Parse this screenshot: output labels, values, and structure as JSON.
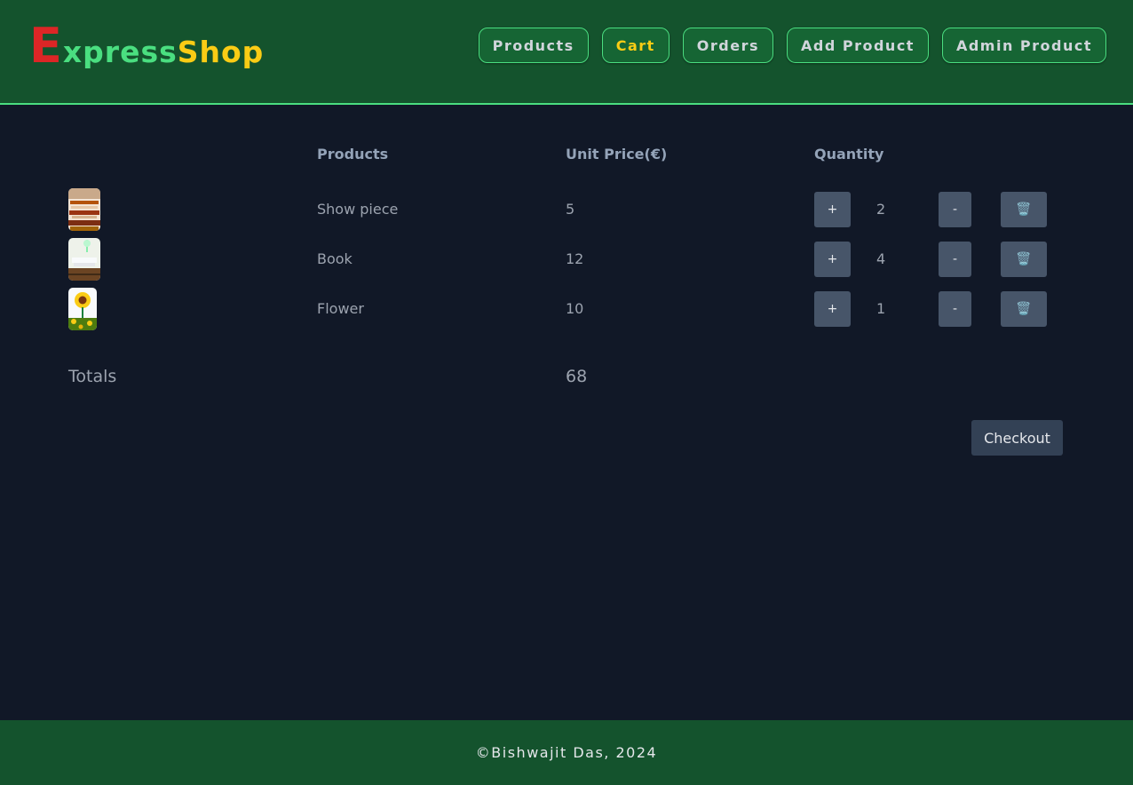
{
  "brand": {
    "first_letter": "E",
    "express": "xpress",
    "shop": "Shop"
  },
  "nav": [
    {
      "label": "Products",
      "active": false
    },
    {
      "label": "Cart",
      "active": true
    },
    {
      "label": "Orders",
      "active": false
    },
    {
      "label": "Add Product",
      "active": false
    },
    {
      "label": "Admin Product",
      "active": false
    }
  ],
  "cart": {
    "headers": {
      "products": "Products",
      "unit_price": "Unit Price(€)",
      "quantity": "Quantity"
    },
    "items": [
      {
        "name": "Show piece",
        "price": "5",
        "qty": "2",
        "image": "show-piece-image"
      },
      {
        "name": "Book",
        "price": "12",
        "qty": "4",
        "image": "book-image"
      },
      {
        "name": "Flower",
        "price": "10",
        "qty": "1",
        "image": "sunflower-image"
      }
    ],
    "increment_label": "+",
    "decrement_label": "-",
    "delete_icon": "🗑️",
    "totals_label": "Totals",
    "totals_value": "68",
    "checkout_label": "Checkout"
  },
  "footer": {
    "text": "©Bishwajit Das, 2024"
  },
  "colors": {
    "header_bg": "#14532d",
    "page_bg": "#111827",
    "logo_e": "#dc2626",
    "logo_express": "#4ade80",
    "logo_shop": "#facc15",
    "button_bg": "#475569"
  }
}
